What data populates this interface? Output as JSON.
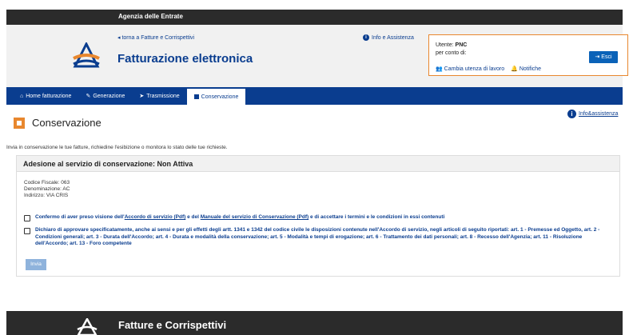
{
  "agency": {
    "title": "Agenzia delle Entrate"
  },
  "header": {
    "back_link": "torna a Fatture e Corrispettivi",
    "app_title": "Fatturazione elettronica",
    "info_link": "Info e Assistenza"
  },
  "user_box": {
    "user_label": "Utente:",
    "user_value": "PNC",
    "for_label": "per conto di:",
    "exit_label": "Esci",
    "change_label": "Cambia utenza di lavoro",
    "notify_label": "Notifiche"
  },
  "nav": {
    "items": [
      {
        "label": "Home fatturazione",
        "icon": "home-icon"
      },
      {
        "label": "Generazione",
        "icon": "pencil-icon"
      },
      {
        "label": "Trasmissione",
        "icon": "send-icon"
      },
      {
        "label": "Conservazione",
        "icon": "box-icon"
      }
    ],
    "active_index": 3
  },
  "help_link": "Info&assistenza",
  "page": {
    "title": "Conservazione",
    "intro": "Invia in conservazione le tue fatture, richiedine l'esibizione o monitora lo stato delle tue richieste."
  },
  "panel": {
    "title": "Adesione al servizio di conservazione: Non Attiva",
    "codice_fiscale": "Codice Fiscale: 063",
    "denominazione": "Denominazione: AC",
    "indirizzo": "Indirizzo: VIA CRIS",
    "check1_pre": "Confermo di aver preso visione dell'",
    "check1_link1": "Accordo di servizio (Pdf)",
    "check1_mid": " e del ",
    "check1_link2": "Manuale del servizio di Conservazione (Pdf)",
    "check1_post": " e di accettare i termini e le condizioni in essi contenuti",
    "check2_text": "Dichiaro di approvare specificatamente, anche ai sensi e per gli effetti degli artt. 1341 e 1342 del codice civile le disposizioni contenute nell'Accordo di servizio, negli articoli di seguito riportati: art. 1 - Premesse ed Oggetto, art. 2 - Condizioni generali; art. 3 - Durata dell'Accordo; art. 4 - Durata e modalità della conservazione; art. 5 - Modalità e tempi di erogazione; art. 6 - Trattamento dei dati personali; art. 8 - Recesso dell'Agenzia; art. 11 - Risoluzione dell'Accordo; art. 13 - Foro competente",
    "send_label": "Invia"
  },
  "footer": {
    "title": "Fatture e Corrispettivi"
  },
  "colors": {
    "primary": "#0a3d8f",
    "accent": "#e8872e",
    "dark": "#2b2b2b"
  }
}
